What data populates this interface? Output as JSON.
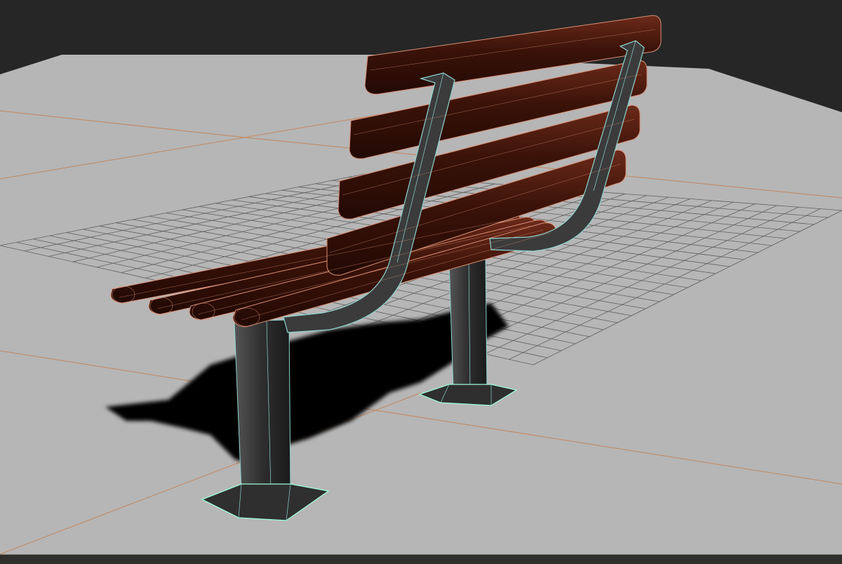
{
  "viewport": {
    "background_color": "#262626",
    "floor_color": "#b6b6b6",
    "grid_line_color": "#1d1d1d",
    "axis_line_color": "#c57d4d",
    "shadow_color": "#050505"
  },
  "bench": {
    "wood_color": "#3a1208",
    "wood_highlight_color": "#6b2a1a",
    "wood_wire_color": "#d88f74",
    "frame_color": "#3b3b3b",
    "frame_wire_color": "#8fd4cf",
    "selected_wire_color": "#9dffd8"
  }
}
